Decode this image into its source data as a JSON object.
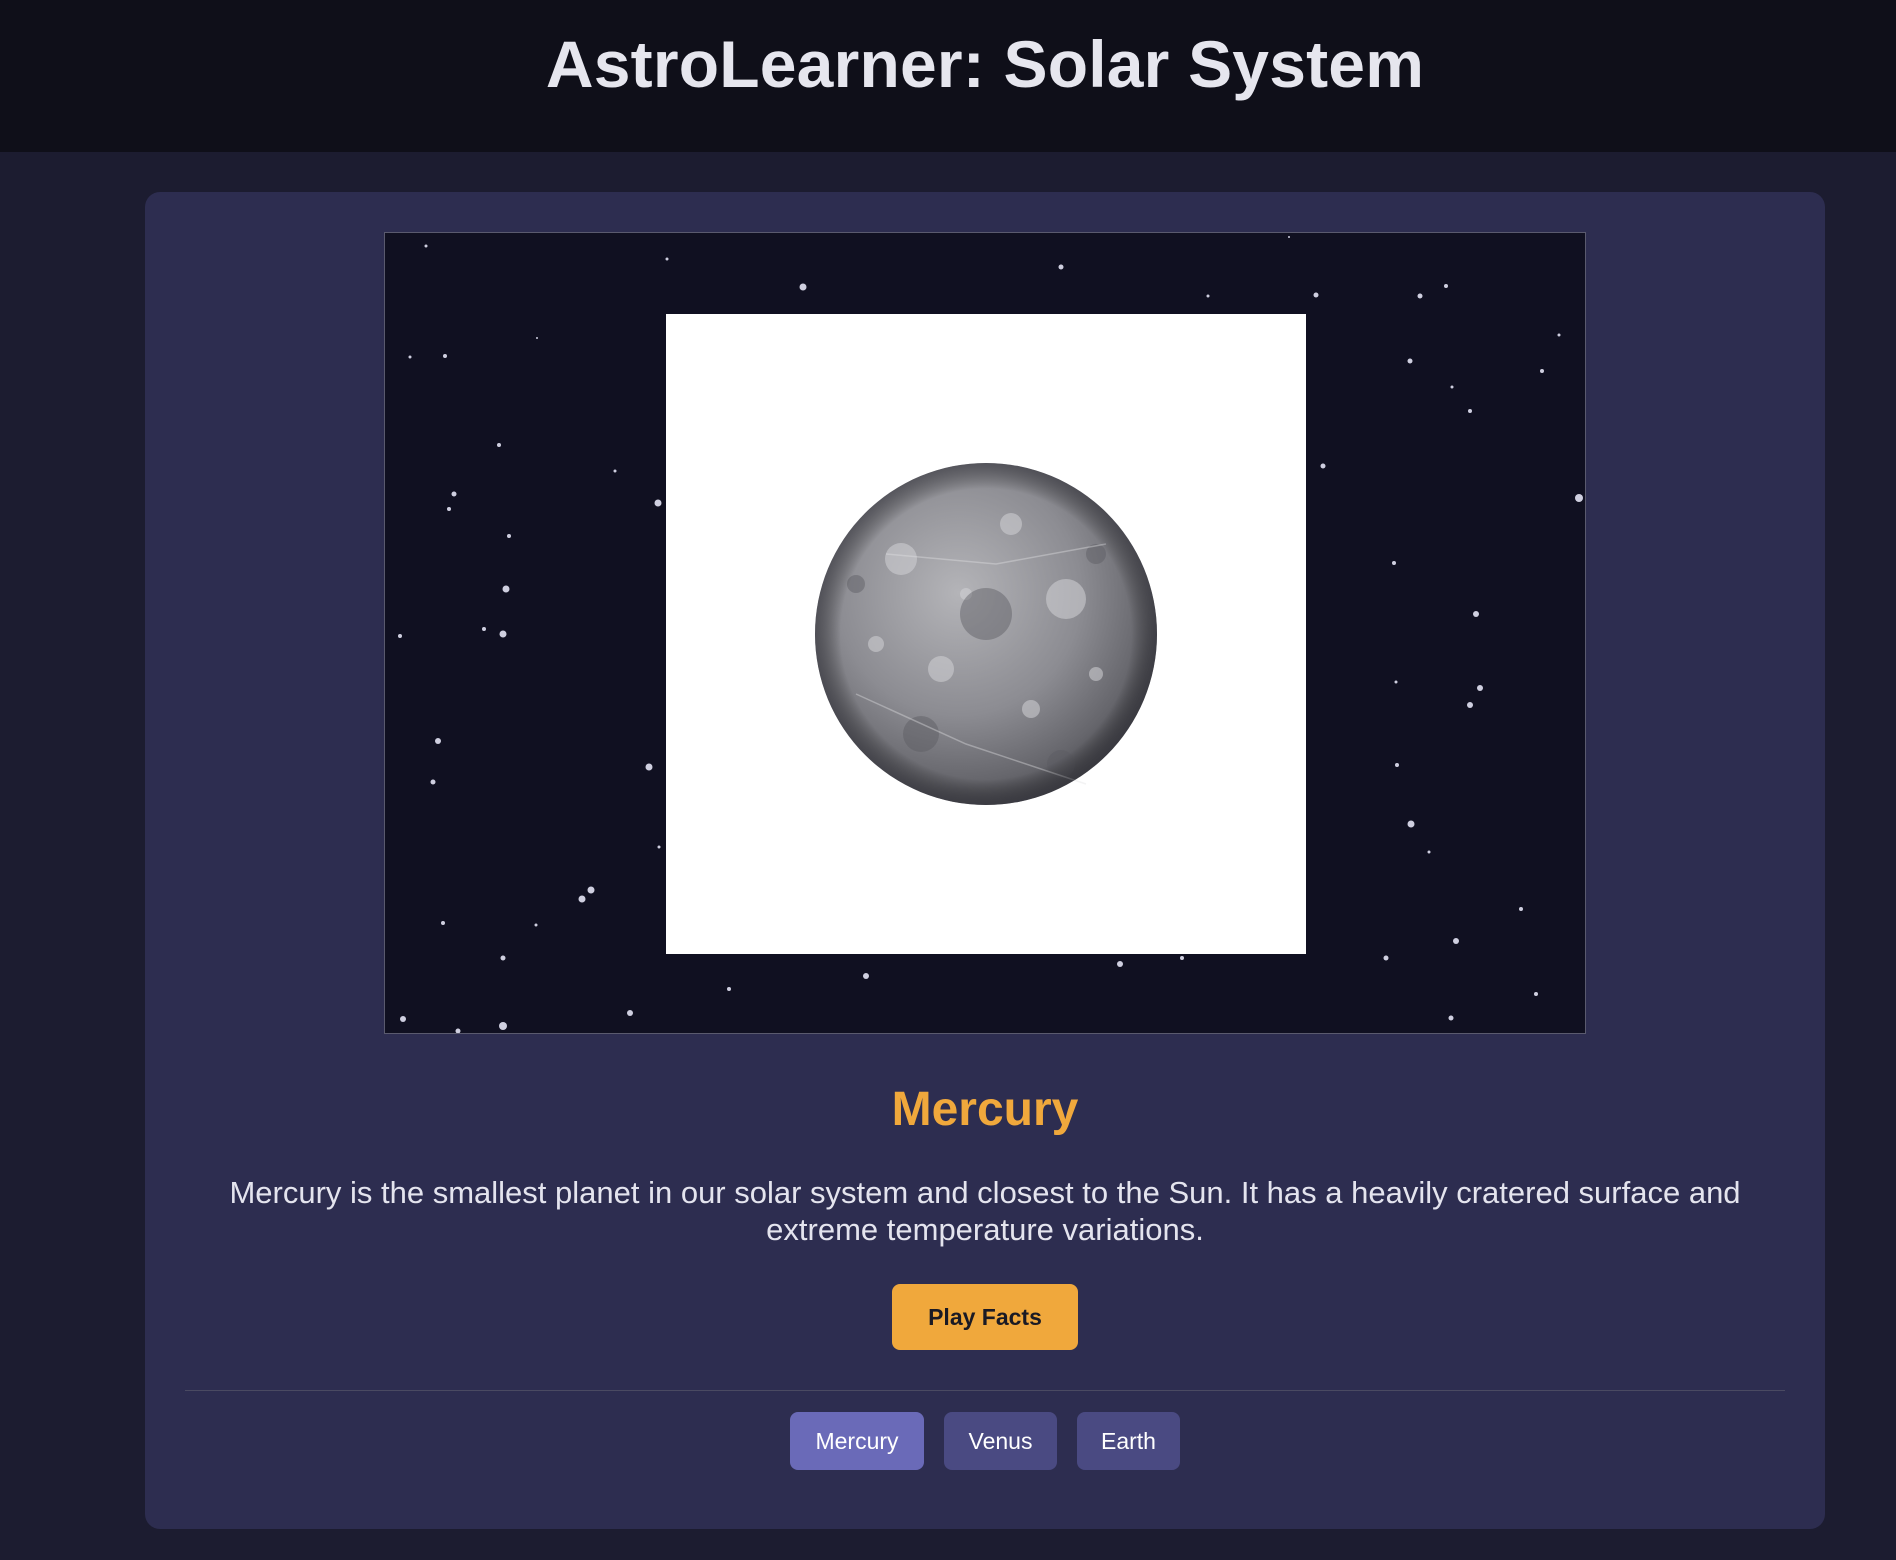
{
  "app": {
    "title": "AstroLearner: Solar System"
  },
  "planet": {
    "name": "Mercury",
    "description": "Mercury is the smallest planet in our solar system and closest to the Sun. It has a heavily cratered surface and extreme temperature variations.",
    "image_icon": "mercury-planet-icon"
  },
  "actions": {
    "play_label": "Play Facts"
  },
  "tabs": [
    {
      "label": "Mercury",
      "active": true
    },
    {
      "label": "Venus",
      "active": false
    },
    {
      "label": "Earth",
      "active": false
    }
  ],
  "colors": {
    "accent": "#f0a83c",
    "card": "#2d2d50",
    "tab_active": "#6a6ab8",
    "tab_inactive": "#4a4a82",
    "space": "#101021"
  }
}
